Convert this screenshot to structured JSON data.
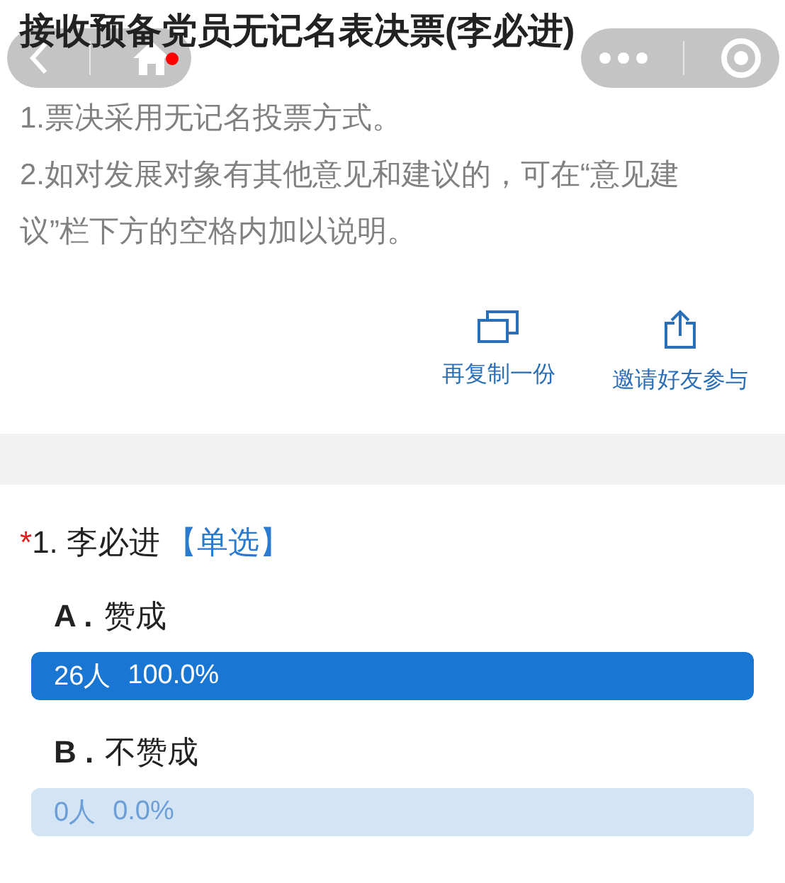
{
  "title": "接收预备党员无记名表决票(李必进)",
  "instructions": [
    "1.票决采用无记名投票方式。",
    "2.如对发展对象有其他意见和建议的，可在“意见建议”栏下方的空格内加以说明。"
  ],
  "actions": [
    {
      "kind": "copy",
      "label": "再复制一份"
    },
    {
      "kind": "share",
      "label": "邀请好友参与"
    }
  ],
  "question": {
    "required_mark": "*",
    "number": "1.",
    "title": "李必进",
    "type": "【单选】",
    "options": [
      {
        "letter": "A .",
        "label": "赞成",
        "count": "26人",
        "percent": "100.0%",
        "level": 1.0
      },
      {
        "letter": "B .",
        "label": "不赞成",
        "count": "0人",
        "percent": "0.0%",
        "level": 0.0
      }
    ]
  }
}
